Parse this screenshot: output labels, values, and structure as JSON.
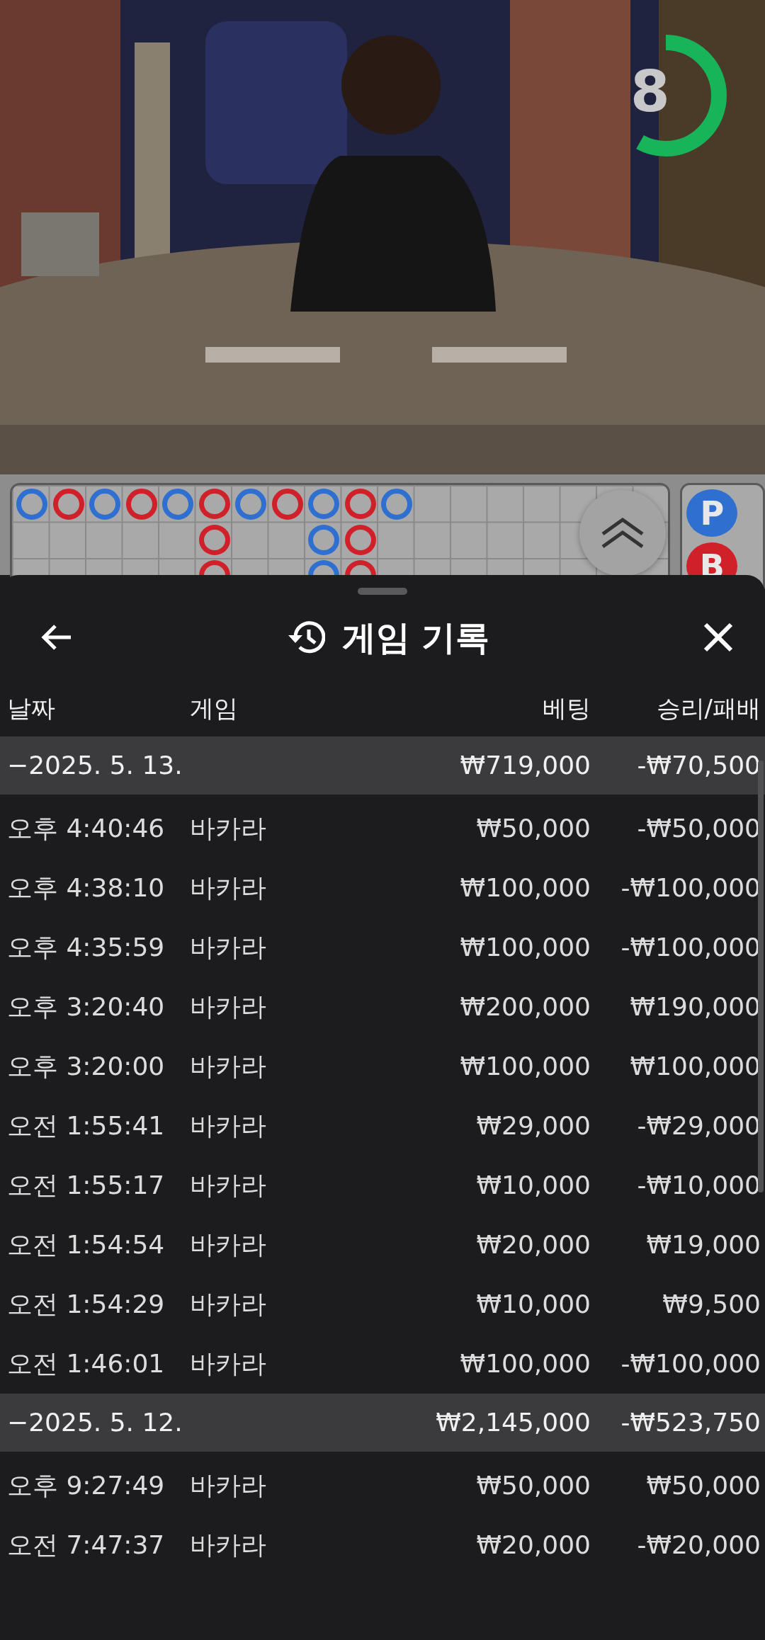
{
  "video": {
    "kind": "picture",
    "timer": {
      "text": "8",
      "level": 0.58
    }
  },
  "road": {
    "columns": [
      [
        {
          "color": "#2f6fd0"
        }
      ],
      [
        {
          "color": "#d0202a"
        }
      ],
      [
        {
          "color": "#2f6fd0"
        }
      ],
      [
        {
          "color": "#d0202a"
        }
      ],
      [
        {
          "color": "#2f6fd0"
        }
      ],
      [
        {
          "color": "#d0202a"
        },
        {
          "color": "#d0202a"
        },
        {
          "color": "#d0202a"
        }
      ],
      [
        {
          "color": "#2f6fd0"
        }
      ],
      [
        {
          "color": "#d0202a"
        }
      ],
      [
        {
          "color": "#2f6fd0"
        },
        {
          "color": "#2f6fd0"
        },
        {
          "color": "#2f6fd0"
        }
      ],
      [
        {
          "color": "#d0202a"
        },
        {
          "color": "#d0202a"
        },
        {
          "color": "#d0202a"
        }
      ],
      [
        {
          "color": "#2f6fd0"
        }
      ]
    ]
  },
  "predictions": [
    {
      "label": "P",
      "color": "#2f6fd0"
    },
    {
      "label": "B",
      "color": "#d0202a"
    }
  ],
  "sheet": {
    "title": "게임 기록",
    "columns": [
      "날짜",
      "게임",
      "베팅",
      "승리/패배"
    ],
    "groups": [
      {
        "date": "−2025. 5. 13.",
        "bet": "₩719,000",
        "result": "-₩70,500",
        "rows": [
          [
            "오후 4:40:46",
            "바카라",
            "₩50,000",
            "-₩50,000"
          ],
          [
            "오후 4:38:10",
            "바카라",
            "₩100,000",
            "-₩100,000"
          ],
          [
            "오후 4:35:59",
            "바카라",
            "₩100,000",
            "-₩100,000"
          ],
          [
            "오후 3:20:40",
            "바카라",
            "₩200,000",
            "₩190,000"
          ],
          [
            "오후 3:20:00",
            "바카라",
            "₩100,000",
            "₩100,000"
          ],
          [
            "오전 1:55:41",
            "바카라",
            "₩29,000",
            "-₩29,000"
          ],
          [
            "오전 1:55:17",
            "바카라",
            "₩10,000",
            "-₩10,000"
          ],
          [
            "오전 1:54:54",
            "바카라",
            "₩20,000",
            "₩19,000"
          ],
          [
            "오전 1:54:29",
            "바카라",
            "₩10,000",
            "₩9,500"
          ],
          [
            "오전 1:46:01",
            "바카라",
            "₩100,000",
            "-₩100,000"
          ]
        ]
      },
      {
        "date": "−2025. 5. 12.",
        "bet": "₩2,145,000",
        "result": "-₩523,750",
        "rows": [
          [
            "오후 9:27:49",
            "바카라",
            "₩50,000",
            "₩50,000"
          ],
          [
            "오전 7:47:37",
            "바카라",
            "₩20,000",
            "-₩20,000"
          ]
        ]
      }
    ]
  }
}
